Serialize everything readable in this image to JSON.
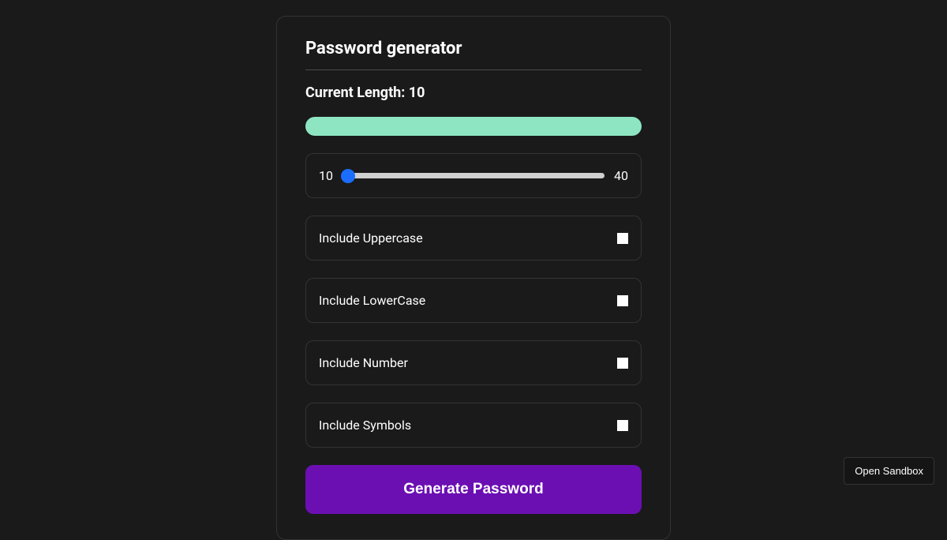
{
  "card": {
    "title": "Password generator",
    "length_label_prefix": "Current Length: ",
    "length_value": "10",
    "slider": {
      "min": "10",
      "max": "40",
      "value": 10
    },
    "options": [
      {
        "label": "Include Uppercase",
        "checked": false
      },
      {
        "label": "Include LowerCase",
        "checked": false
      },
      {
        "label": "Include Number",
        "checked": false
      },
      {
        "label": "Include Symbols",
        "checked": false
      }
    ],
    "generate_button": "Generate Password",
    "password_output": ""
  },
  "footer": {
    "open_sandbox": "Open Sandbox"
  },
  "colors": {
    "background": "#1a1a1a",
    "accent_green": "#8ee5c2",
    "accent_purple": "#6b0fb3",
    "slider_thumb": "#1a6dff"
  }
}
